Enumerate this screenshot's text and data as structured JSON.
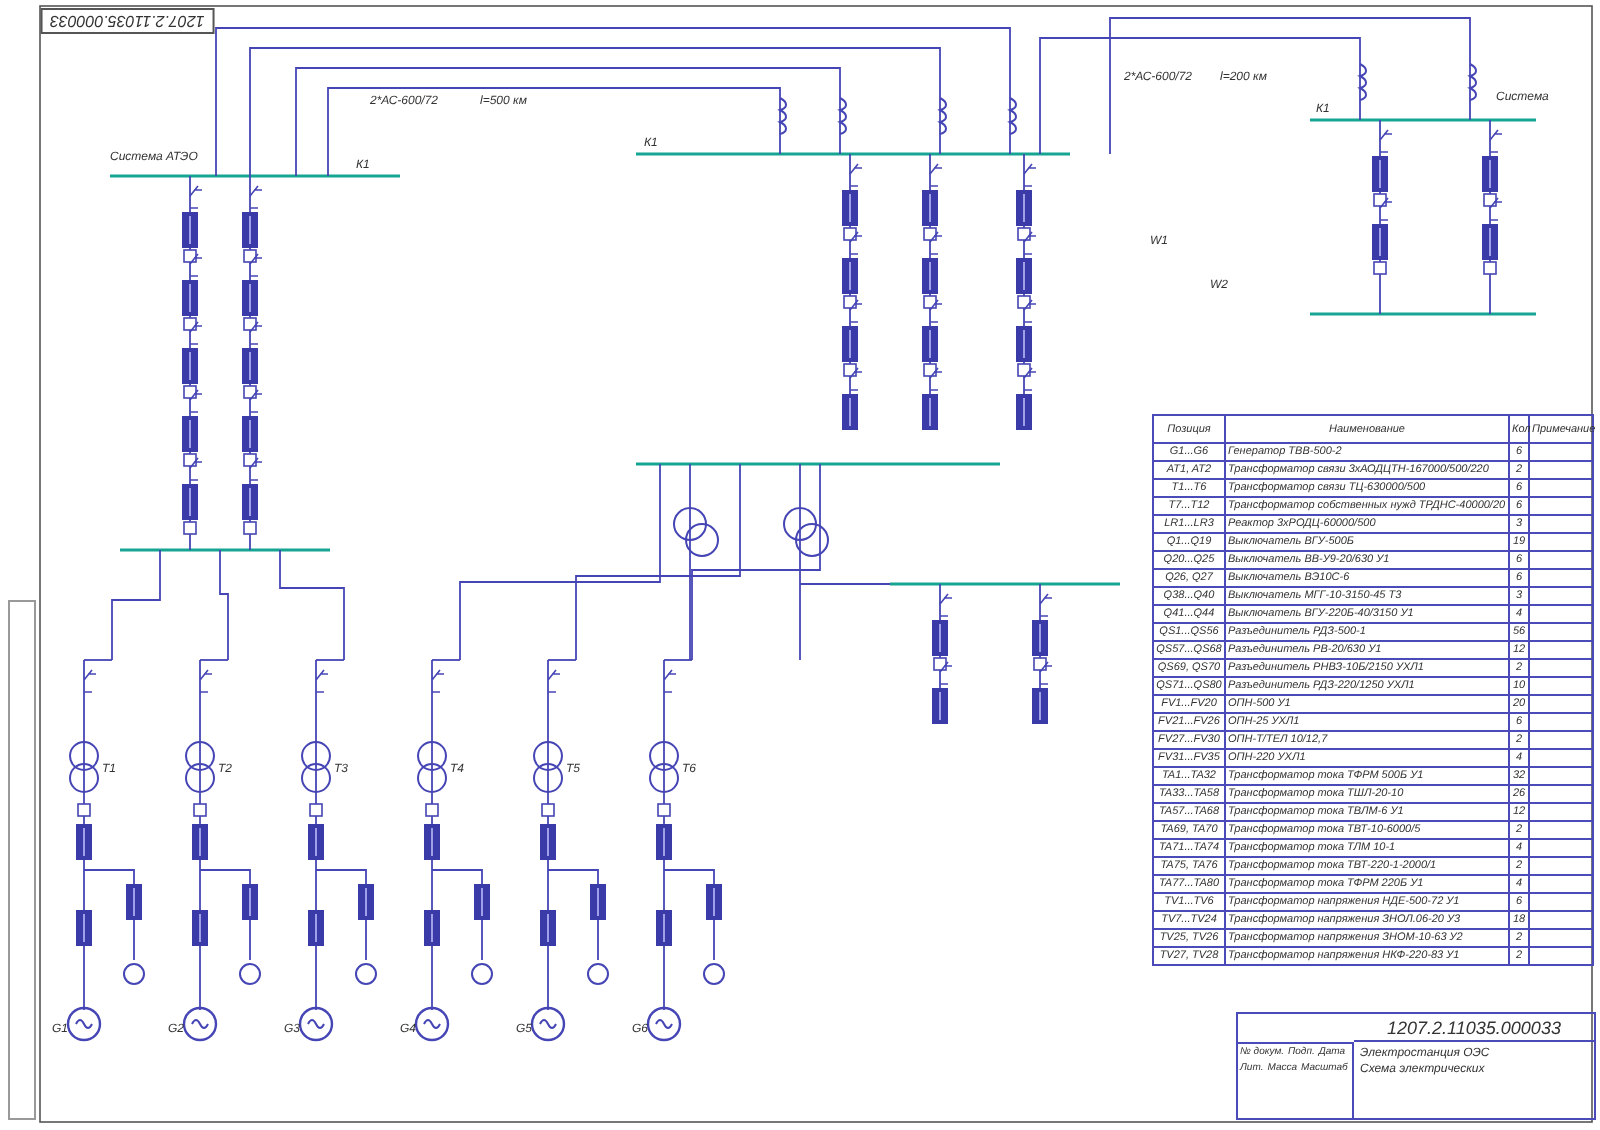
{
  "stamp": "1207.2.11035.000033",
  "schematic": {
    "system_left": "Система АТЭО",
    "system_right": "Система",
    "bus_labels": [
      "К1",
      "К1",
      "К1"
    ],
    "lines": [
      {
        "cable": "2*АС-600/72",
        "length": "l=500 км"
      },
      {
        "cable": "2*АС-600/72",
        "length": "l=200 км"
      }
    ],
    "outgoing": [
      "W1",
      "W2"
    ],
    "units": [
      {
        "generator": "G1",
        "transformer": "T1"
      },
      {
        "generator": "G2",
        "transformer": "T2"
      },
      {
        "generator": "G3",
        "transformer": "T3"
      },
      {
        "generator": "G4",
        "transformer": "T4"
      },
      {
        "generator": "G5",
        "transformer": "T5"
      },
      {
        "generator": "G6",
        "transformer": "T6"
      }
    ]
  },
  "specification": {
    "columns": [
      "Позиция",
      "Наименование",
      "Кол",
      "Примечание"
    ],
    "rows": [
      {
        "position": "G1...G6",
        "name": "Генератор ТВВ-500-2",
        "quantity": "6"
      },
      {
        "position": "AT1, AT2",
        "name": "Трансформатор связи 3хАОДЦТН-167000/500/220",
        "quantity": "2"
      },
      {
        "position": "T1...T6",
        "name": "Трансформатор связи ТЦ-630000/500",
        "quantity": "6"
      },
      {
        "position": "T7...T12",
        "name": "Трансформатор собственных нужд ТРДНС-40000/20",
        "quantity": "6"
      },
      {
        "position": "LR1...LR3",
        "name": "Реактор 3хРОДЦ-60000/500",
        "quantity": "3"
      },
      {
        "position": "Q1...Q19",
        "name": "Выключатель ВГУ-500Б",
        "quantity": "19"
      },
      {
        "position": "Q20...Q25",
        "name": "Выключатель ВВ-У9-20/630 У1",
        "quantity": "6"
      },
      {
        "position": "Q26, Q27",
        "name": "Выключатель ВЭ10С-6",
        "quantity": "6"
      },
      {
        "position": "Q38...Q40",
        "name": "Выключатель МГГ-10-3150-45 Т3",
        "quantity": "3"
      },
      {
        "position": "Q41...Q44",
        "name": "Выключатель ВГУ-220Б-40/3150 У1",
        "quantity": "4"
      },
      {
        "position": "QS1...QS56",
        "name": "Разъединитель РДЗ-500-1",
        "quantity": "56"
      },
      {
        "position": "QS57...QS68",
        "name": "Разъединитель РВ-20/630 У1",
        "quantity": "12"
      },
      {
        "position": "QS69, QS70",
        "name": "Разъединитель РНВЗ-10Б/2150 УХЛ1",
        "quantity": "2"
      },
      {
        "position": "QS71...QS80",
        "name": "Разъединитель РДЗ-220/1250 УХЛ1",
        "quantity": "10"
      },
      {
        "position": "FV1...FV20",
        "name": "ОПН-500 У1",
        "quantity": "20"
      },
      {
        "position": "FV21...FV26",
        "name": "ОПН-25 УХЛ1",
        "quantity": "6"
      },
      {
        "position": "FV27...FV30",
        "name": "ОПН-Т/ТЕЛ 10/12,7",
        "quantity": "2"
      },
      {
        "position": "FV31...FV35",
        "name": "ОПН-220 УХЛ1",
        "quantity": "4"
      },
      {
        "position": "TA1...TA32",
        "name": "Трансформатор тока ТФРМ 500Б У1",
        "quantity": "32"
      },
      {
        "position": "TA33...TA58",
        "name": "Трансформатор тока ТШЛ-20-10",
        "quantity": "26"
      },
      {
        "position": "TA57...TA68",
        "name": "Трансформатор тока ТВЛМ-6 У1",
        "quantity": "12"
      },
      {
        "position": "TA69, TA70",
        "name": "Трансформатор тока ТВТ-10-6000/5",
        "quantity": "2"
      },
      {
        "position": "TA71...TA74",
        "name": "Трансформатор тока ТЛМ 10-1",
        "quantity": "4"
      },
      {
        "position": "TA75, TA76",
        "name": "Трансформатор тока ТВТ-220-1-2000/1",
        "quantity": "2"
      },
      {
        "position": "TA77...TA80",
        "name": "Трансформатор тока ТФРМ 220Б У1",
        "quantity": "4"
      },
      {
        "position": "TV1...TV6",
        "name": "Трансформатор напряжения НДЕ-500-72 У1",
        "quantity": "6"
      },
      {
        "position": "TV7...TV24",
        "name": "Трансформатор напряжения ЗНОЛ.06-20 У3",
        "quantity": "18"
      },
      {
        "position": "TV25, TV26",
        "name": "Трансформатор напряжения ЗНОМ-10-63 У2",
        "quantity": "2"
      },
      {
        "position": "TV27, TV28",
        "name": "Трансформатор напряжения НКФ-220-83 У1",
        "quantity": "2"
      }
    ]
  },
  "title_block": {
    "headers": [
      "№ докум.",
      "Подп.",
      "Дата",
      "Лит.",
      "Масса",
      "Масштаб"
    ],
    "designation": "1207.2.11035.000033",
    "title": [
      "Электростанция ОЭС",
      "Схема электрических"
    ]
  }
}
